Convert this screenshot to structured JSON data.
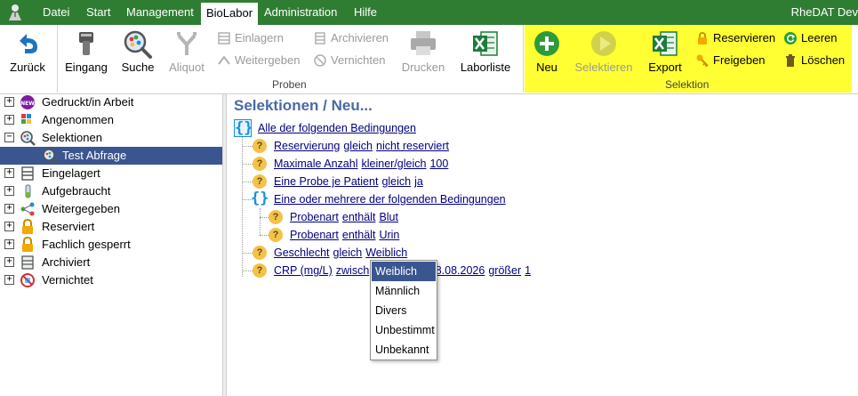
{
  "menubar": {
    "items": [
      "Datei",
      "Start",
      "Management",
      "BioLabor",
      "Administration",
      "Hilfe"
    ],
    "active": "BioLabor",
    "app_title": "RheDAT Dev"
  },
  "ribbon": {
    "zurueck": "Zurück",
    "eingang": "Eingang",
    "suche": "Suche",
    "aliquot": "Aliquot",
    "einlagern": "Einlagern",
    "weitergeben": "Weitergeben",
    "archivieren": "Archivieren",
    "vernichten": "Vernichten",
    "drucken": "Drucken",
    "laborliste": "Laborliste",
    "proben_group": "Proben",
    "neu": "Neu",
    "selektieren": "Selektieren",
    "export": "Export",
    "reservieren": "Reservieren",
    "freigeben": "Freigeben",
    "leeren": "Leeren",
    "loeschen": "Löschen",
    "selektion_group": "Selektion"
  },
  "tree": {
    "items": [
      {
        "label": "Gedruckt/in Arbeit",
        "icon": "new-badge-icon",
        "expander": "+"
      },
      {
        "label": "Angenommen",
        "icon": "grid-icon",
        "expander": "+"
      },
      {
        "label": "Selektionen",
        "icon": "magnifier-icon",
        "expander": "−"
      },
      {
        "label": "Test Abfrage",
        "icon": "magnifier-icon",
        "expander": ""
      },
      {
        "label": "Eingelagert",
        "icon": "rack-icon",
        "expander": "+"
      },
      {
        "label": "Aufgebraucht",
        "icon": "tube-icon",
        "expander": "+"
      },
      {
        "label": "Weitergegeben",
        "icon": "share-icon",
        "expander": "+"
      },
      {
        "label": "Reserviert",
        "icon": "lock-icon",
        "expander": "+"
      },
      {
        "label": "Fachlich gesperrt",
        "icon": "lock-icon",
        "expander": "+"
      },
      {
        "label": "Archiviert",
        "icon": "archive-icon",
        "expander": "+"
      },
      {
        "label": "Vernichtet",
        "icon": "prohibited-icon",
        "expander": "+"
      }
    ]
  },
  "panel": {
    "title": "Selektionen / Neu...",
    "root": "Alle der folgenden Bedingungen",
    "c1": {
      "field": "Reservierung",
      "op": "gleich",
      "value": "nicht reserviert"
    },
    "c2": {
      "field": "Maximale Anzahl",
      "op": "kleiner/gleich",
      "value": "100"
    },
    "c3": {
      "field": "Eine Probe je Patient",
      "op": "gleich",
      "value": "ja"
    },
    "group2": "Eine oder mehrere der folgenden Bedingungen",
    "c4": {
      "field": "Probenart",
      "op": "enthält",
      "value": "Blut"
    },
    "c5": {
      "field": "Probenart",
      "op": "enthält",
      "value": "Urin"
    },
    "c6": {
      "field": "Geschlecht",
      "op": "gleich",
      "value": "Weiblich"
    },
    "c7": {
      "field": "CRP (mg/L)",
      "op": "zwisch",
      "value": "6 und 08.08.2026",
      "op2": "größer",
      "value2": "1"
    }
  },
  "dropdown": {
    "options": [
      "Weiblich",
      "Männlich",
      "Divers",
      "Unbestimmt",
      "Unbekannt"
    ],
    "selected": "Weiblich"
  },
  "colors": {
    "menubar": "#2f7d32",
    "selection": "#3a5590",
    "highlight": "#ffff33",
    "title": "#4a6aa5",
    "link": "#000080"
  }
}
